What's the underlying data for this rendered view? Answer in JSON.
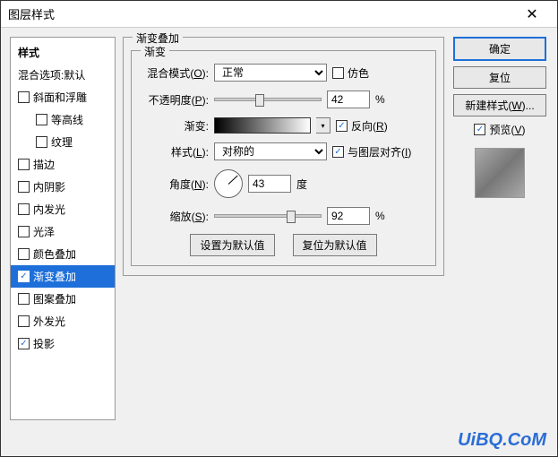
{
  "window": {
    "title": "图层样式"
  },
  "left": {
    "header": "样式",
    "blendOptions": "混合选项:默认",
    "items": [
      {
        "label": "斜面和浮雕",
        "checked": false
      },
      {
        "label": "等高线",
        "checked": false
      },
      {
        "label": "纹理",
        "checked": false
      },
      {
        "label": "描边",
        "checked": false
      },
      {
        "label": "内阴影",
        "checked": false
      },
      {
        "label": "内发光",
        "checked": false
      },
      {
        "label": "光泽",
        "checked": false
      },
      {
        "label": "颜色叠加",
        "checked": false
      },
      {
        "label": "渐变叠加",
        "checked": true,
        "active": true
      },
      {
        "label": "图案叠加",
        "checked": false
      },
      {
        "label": "外发光",
        "checked": false
      },
      {
        "label": "投影",
        "checked": true
      }
    ]
  },
  "center": {
    "groupTitle": "渐变叠加",
    "innerTitle": "渐变",
    "blendMode": {
      "label": "混合模式",
      "key": "O",
      "value": "正常"
    },
    "dither": "仿色",
    "opacity": {
      "label": "不透明度",
      "key": "P",
      "value": "42",
      "unit": "%"
    },
    "gradient": {
      "label": "渐变"
    },
    "reverse": {
      "label": "反向",
      "key": "R",
      "checked": true
    },
    "style": {
      "label": "样式",
      "key": "L",
      "value": "对称的"
    },
    "align": {
      "label": "与图层对齐",
      "key": "I",
      "checked": true
    },
    "angle": {
      "label": "角度",
      "key": "N",
      "value": "43",
      "unit": "度"
    },
    "scale": {
      "label": "缩放",
      "key": "S",
      "value": "92",
      "unit": "%"
    },
    "makeDefault": "设置为默认值",
    "resetDefault": "复位为默认值"
  },
  "right": {
    "ok": "确定",
    "cancel": "复位",
    "newStyle": {
      "label": "新建样式",
      "key": "W"
    },
    "preview": {
      "label": "预览",
      "key": "V",
      "checked": true
    }
  },
  "watermark": "UiBQ.CoM"
}
